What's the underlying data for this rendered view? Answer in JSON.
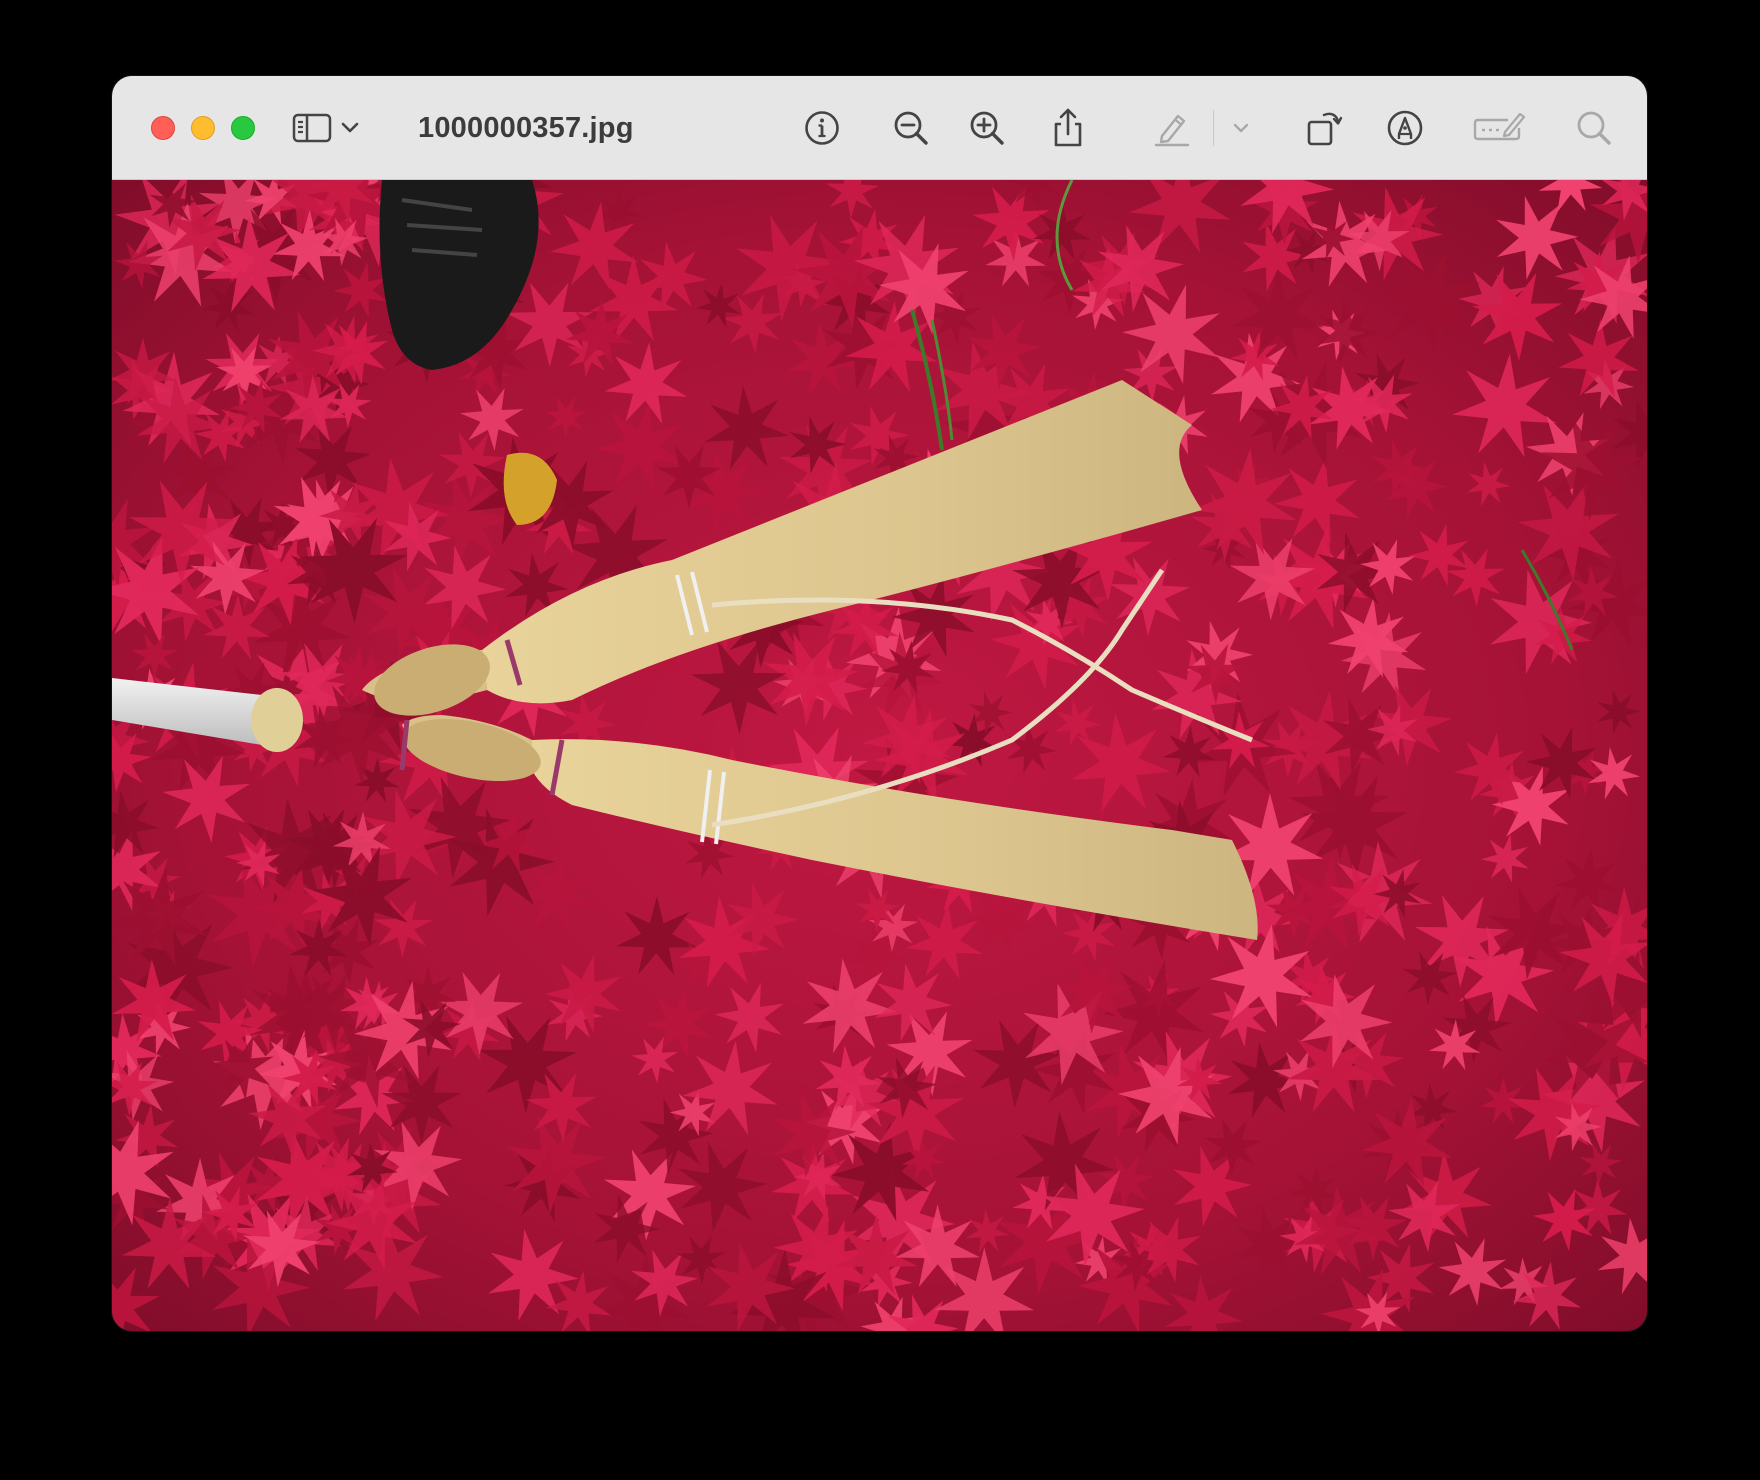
{
  "window": {
    "title": "1000000357.jpg"
  },
  "toolbar": {
    "buttons": [
      {
        "name": "sidebar-toggle",
        "icon": "sidebar-icon"
      },
      {
        "name": "sidebar-menu",
        "icon": "chevron-down-icon"
      },
      {
        "name": "info",
        "icon": "info-icon"
      },
      {
        "name": "zoom-out",
        "icon": "zoom-out-icon"
      },
      {
        "name": "zoom-in",
        "icon": "zoom-in-icon"
      },
      {
        "name": "share",
        "icon": "share-icon"
      },
      {
        "name": "highlight",
        "icon": "pencil-icon",
        "enabled": false
      },
      {
        "name": "highlight-menu",
        "icon": "chevron-down-icon",
        "enabled": false
      },
      {
        "name": "rotate",
        "icon": "rotate-icon"
      },
      {
        "name": "markup",
        "icon": "markup-icon"
      },
      {
        "name": "form-fill",
        "icon": "form-fill-icon",
        "enabled": false
      },
      {
        "name": "search",
        "icon": "search-icon",
        "enabled": false
      }
    ]
  },
  "colors": {
    "close": "#ff5f57",
    "minimize": "#febc2e",
    "maximize": "#28c840",
    "toolbar_bg": "#e6e6e6",
    "icon": "#444444",
    "icon_disabled": "#a8a8a8"
  },
  "image": {
    "subject": "two-besoms-on-red-maple-leaves"
  }
}
